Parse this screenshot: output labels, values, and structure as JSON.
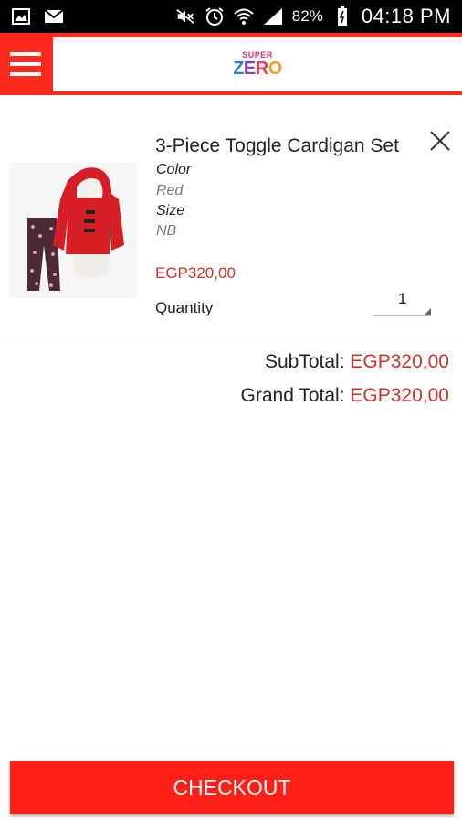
{
  "status_bar": {
    "battery_percent": "82%",
    "time": "04:18 PM"
  },
  "header": {
    "logo_top": "SUPER",
    "logo_bottom": "ZERO"
  },
  "cart_item": {
    "title": "3-Piece Toggle Cardigan Set",
    "color_label": "Color",
    "color_value": "Red",
    "size_label": "Size",
    "size_value": "NB",
    "price": "EGP320,00",
    "quantity_label": "Quantity",
    "quantity_value": "1"
  },
  "totals": {
    "subtotal_label": "SubTotal:",
    "subtotal_value": "EGP320,00",
    "grand_total_label": "Grand Total:",
    "grand_total_value": "EGP320,00"
  },
  "checkout_label": "CHECKOUT",
  "colors": {
    "brand_red": "#ff2a1c",
    "price_red": "#d0322a"
  }
}
